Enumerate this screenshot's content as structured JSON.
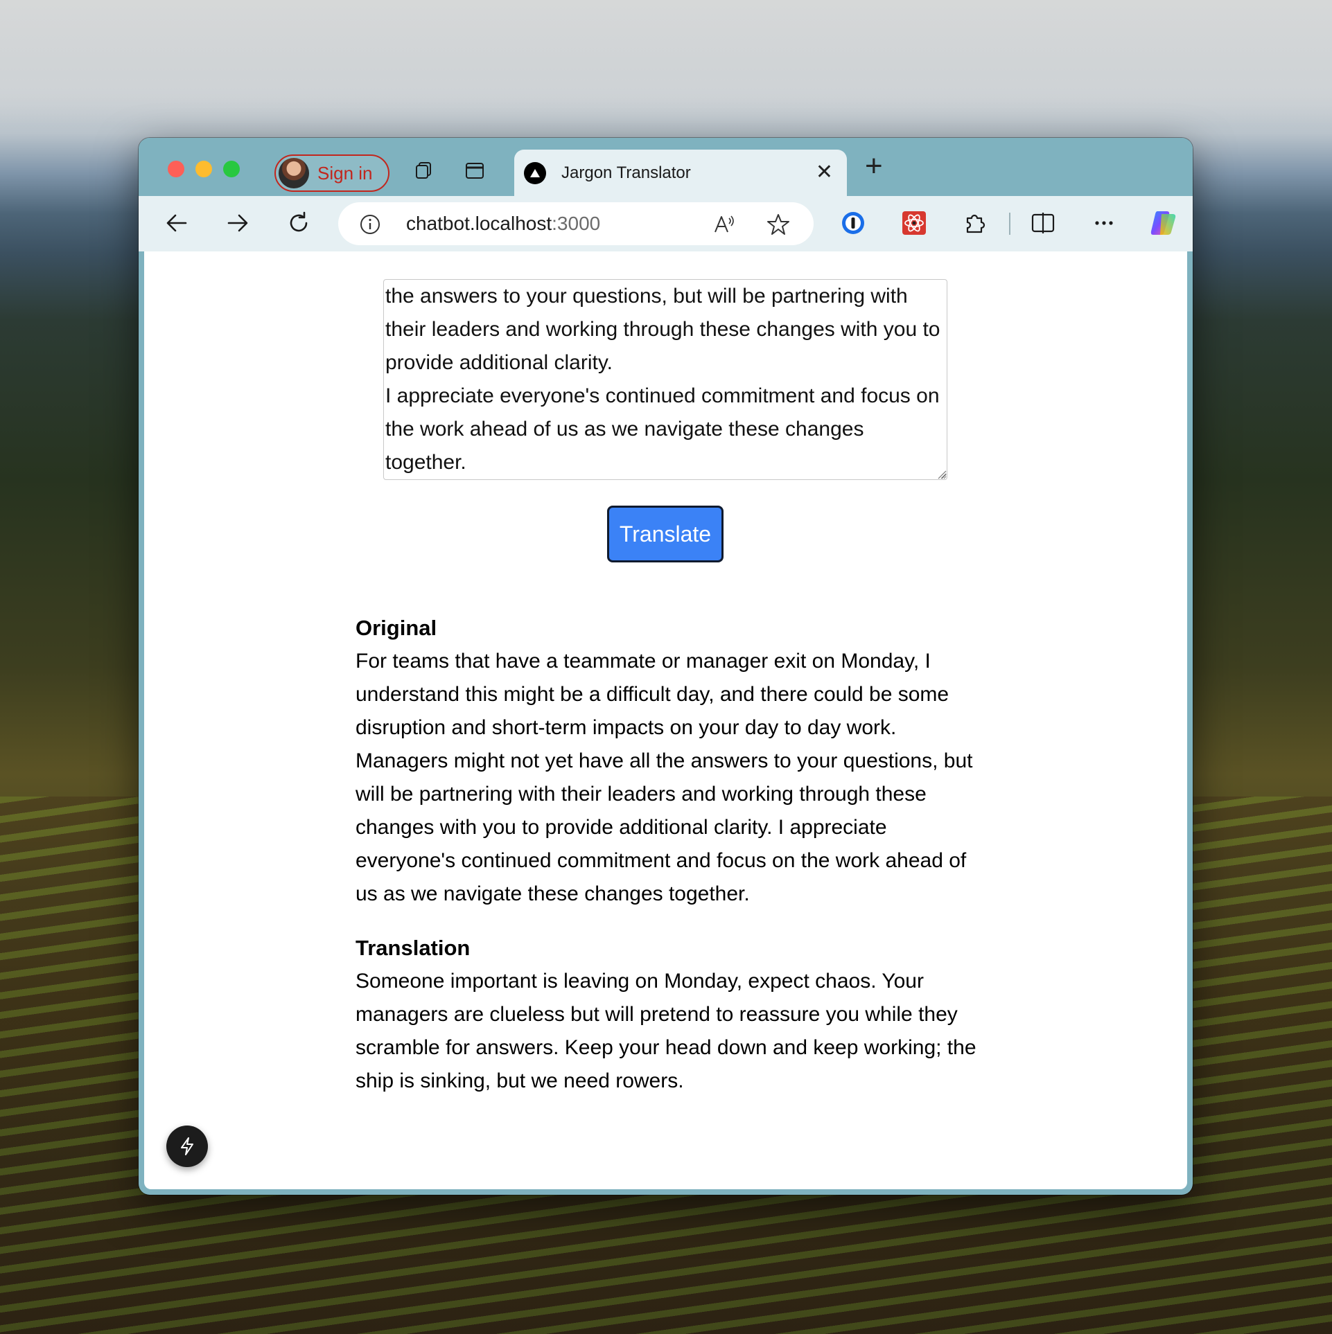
{
  "browser": {
    "profile_label": "Sign in",
    "tab_title": "Jargon Translator",
    "url_host": "chatbot.localhost",
    "url_port": ":3000"
  },
  "page": {
    "input_text": "the answers to your questions, but will be partnering with their leaders and working through these changes with you to provide additional clarity.\nI appreciate everyone's continued commitment and focus on the work ahead of us as we navigate these changes together.",
    "translate_label": "Translate",
    "original_heading": "Original",
    "original_text": "For teams that have a teammate or manager exit on Monday, I understand this might be a difficult day, and there could be some disruption and short-term impacts on your day to day work. Managers might not yet have all the answers to your questions, but will be partnering with their leaders and working through these changes with you to provide additional clarity. I appreciate everyone's continued commitment and focus on the work ahead of us as we navigate these changes together.",
    "translation_heading": "Translation",
    "translation_text": "Someone important is leaving on Monday, expect chaos. Your managers are clueless but will pretend to reassure you while they scramble for answers. Keep your head down and keep working; the ship is sinking, but we need rowers."
  },
  "colors": {
    "accent_button": "#3b82f6",
    "signin_red": "#c2261d",
    "tabbar": "#7fb2bf"
  }
}
